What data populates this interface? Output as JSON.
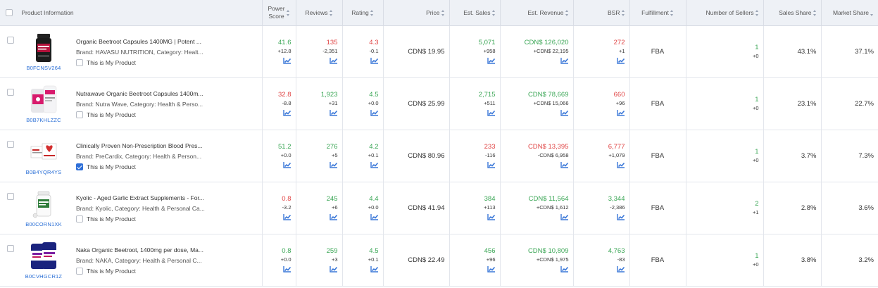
{
  "columns": {
    "product_information": "Product Information",
    "power_score_l1": "Power",
    "power_score_l2": "Score",
    "reviews": "Reviews",
    "rating": "Rating",
    "price": "Price",
    "est_sales": "Est. Sales",
    "est_revenue": "Est. Revenue",
    "bsr": "BSR",
    "fulfillment": "Fulfillment",
    "number_of_sellers": "Number of Sellers",
    "sales_share": "Sales Share",
    "market_share": "Market Share"
  },
  "my_product_label": "This is My Product",
  "rows": [
    {
      "asin": "B0FCNSV264",
      "title": "Organic Beetroot Capsules 1400MG | Potent ...",
      "brand": "Brand: HAVASU NUTRITION,  Category: Healt...",
      "my_product": false,
      "power_score": "41.6",
      "power_score_delta": "+12.8",
      "power_score_dir": "pos",
      "reviews": "135",
      "reviews_delta": "-2,351",
      "reviews_dir": "neg",
      "rating": "4.3",
      "rating_delta": "-0.1",
      "rating_dir": "neg",
      "price": "CDN$ 19.95",
      "est_sales": "5,071",
      "est_sales_delta": "+958",
      "est_sales_dir": "pos",
      "est_revenue": "CDN$ 126,020",
      "est_revenue_delta": "+CDN$ 22,195",
      "est_revenue_dir": "pos",
      "bsr": "272",
      "bsr_delta": "+1",
      "bsr_dir": "neg",
      "fulfillment": "FBA",
      "sellers": "1",
      "sellers_delta": "+0",
      "sellers_dir": "pos",
      "sales_share": "43.1%",
      "market_share": "37.1%"
    },
    {
      "asin": "B0B7KHLZZC",
      "title": "Nutrawave Organic Beetroot Capsules 1400m...",
      "brand": "Brand: Nutra Wave,  Category: Health & Perso...",
      "my_product": false,
      "power_score": "32.8",
      "power_score_delta": "-8.8",
      "power_score_dir": "neg",
      "reviews": "1,923",
      "reviews_delta": "+31",
      "reviews_dir": "pos",
      "rating": "4.5",
      "rating_delta": "+0.0",
      "rating_dir": "pos",
      "price": "CDN$ 25.99",
      "est_sales": "2,715",
      "est_sales_delta": "+511",
      "est_sales_dir": "pos",
      "est_revenue": "CDN$ 78,669",
      "est_revenue_delta": "+CDN$ 15,066",
      "est_revenue_dir": "pos",
      "bsr": "660",
      "bsr_delta": "+96",
      "bsr_dir": "neg",
      "fulfillment": "FBA",
      "sellers": "1",
      "sellers_delta": "+0",
      "sellers_dir": "pos",
      "sales_share": "23.1%",
      "market_share": "22.7%"
    },
    {
      "asin": "B0B4YQR4YS",
      "title": "Clinically Proven Non-Prescription Blood Pres...",
      "brand": "Brand: PreCardix,  Category: Health & Person...",
      "my_product": true,
      "power_score": "51.2",
      "power_score_delta": "+0.0",
      "power_score_dir": "pos",
      "reviews": "276",
      "reviews_delta": "+5",
      "reviews_dir": "pos",
      "rating": "4.2",
      "rating_delta": "+0.1",
      "rating_dir": "pos",
      "price": "CDN$ 80.96",
      "est_sales": "233",
      "est_sales_delta": "-116",
      "est_sales_dir": "neg",
      "est_revenue": "CDN$ 13,395",
      "est_revenue_delta": "-CDN$ 6,958",
      "est_revenue_dir": "neg",
      "bsr": "6,777",
      "bsr_delta": "+1,079",
      "bsr_dir": "neg",
      "fulfillment": "FBA",
      "sellers": "1",
      "sellers_delta": "+0",
      "sellers_dir": "pos",
      "sales_share": "3.7%",
      "market_share": "7.3%"
    },
    {
      "asin": "B00CORN1XK",
      "title": "Kyolic - Aged Garlic Extract Supplements - For...",
      "brand": "Brand: Kyolic,  Category: Health & Personal Ca...",
      "my_product": false,
      "power_score": "0.8",
      "power_score_delta": "-3.2",
      "power_score_dir": "neg",
      "reviews": "245",
      "reviews_delta": "+6",
      "reviews_dir": "pos",
      "rating": "4.4",
      "rating_delta": "+0.0",
      "rating_dir": "pos",
      "price": "CDN$ 41.94",
      "est_sales": "384",
      "est_sales_delta": "+113",
      "est_sales_dir": "pos",
      "est_revenue": "CDN$ 11,564",
      "est_revenue_delta": "+CDN$ 1,612",
      "est_revenue_dir": "pos",
      "bsr": "3,344",
      "bsr_delta": "-2,386",
      "bsr_dir": "pos",
      "fulfillment": "FBA",
      "sellers": "2",
      "sellers_delta": "+1",
      "sellers_dir": "pos",
      "sales_share": "2.8%",
      "market_share": "3.6%"
    },
    {
      "asin": "B0CVHGCR1Z",
      "title": "Naka Organic Beetroot, 1400mg per dose, Ma...",
      "brand": "Brand: NAKA,  Category: Health & Personal C...",
      "my_product": false,
      "power_score": "0.8",
      "power_score_delta": "+0.0",
      "power_score_dir": "pos",
      "reviews": "259",
      "reviews_delta": "+3",
      "reviews_dir": "pos",
      "rating": "4.5",
      "rating_delta": "+0.1",
      "rating_dir": "pos",
      "price": "CDN$ 22.49",
      "est_sales": "456",
      "est_sales_delta": "+96",
      "est_sales_dir": "pos",
      "est_revenue": "CDN$ 10,809",
      "est_revenue_delta": "+CDN$ 1,975",
      "est_revenue_dir": "pos",
      "bsr": "4,763",
      "bsr_delta": "-83",
      "bsr_dir": "pos",
      "fulfillment": "FBA",
      "sellers": "1",
      "sellers_delta": "+0",
      "sellers_dir": "pos",
      "sales_share": "3.8%",
      "market_share": "3.2%"
    }
  ],
  "colors": {
    "positive": "#3aa655",
    "negative": "#e04545",
    "link": "#2a6fd6",
    "header_bg": "#eef1f6"
  },
  "icons": {
    "trend": "trend-chart-icon",
    "sort": "sort-icon"
  }
}
